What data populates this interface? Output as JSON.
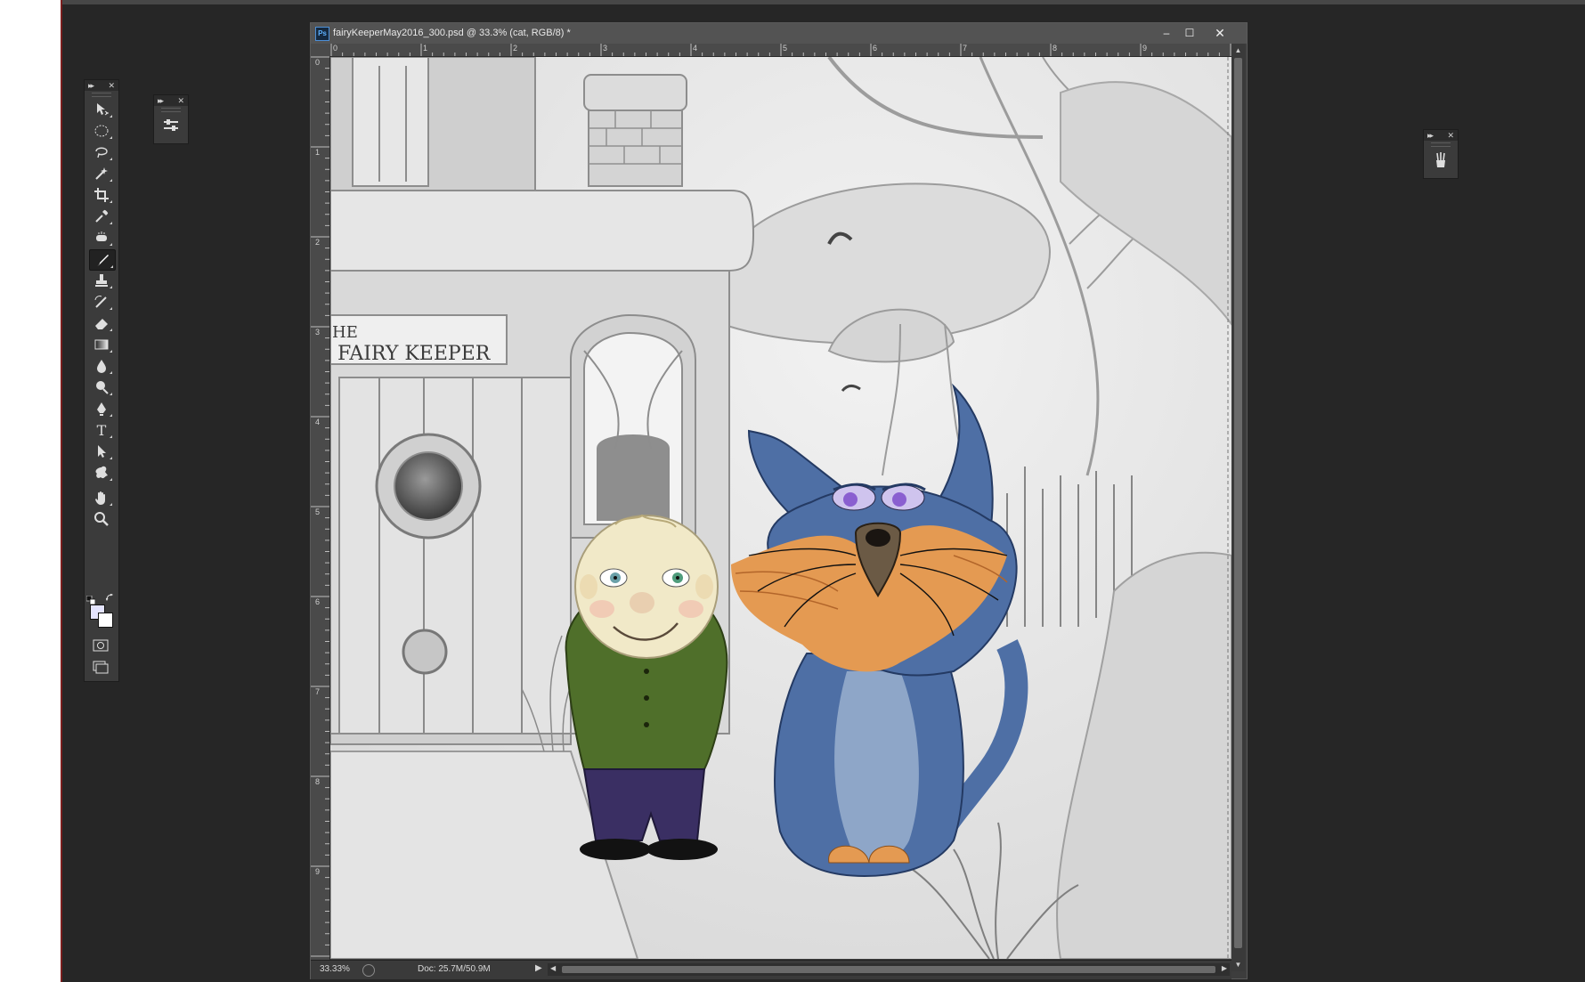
{
  "document": {
    "ps_badge": "Ps",
    "title": "fairyKeeperMay2016_300.psd @ 33.3% (cat, RGB/8) *",
    "window_buttons": {
      "minimize": "–",
      "maximize": "☐",
      "close": "✕"
    },
    "ruler_top_labels": [
      "0",
      "1",
      "2",
      "3",
      "4",
      "5",
      "6",
      "7",
      "8",
      "9"
    ],
    "ruler_left_labels": [
      "0",
      "1",
      "2",
      "3",
      "4",
      "5",
      "6",
      "7",
      "8",
      "9"
    ],
    "canvas_sign_line1": "HE",
    "canvas_sign_line2": "FAIRY KEEPER"
  },
  "status_bar": {
    "zoom": "33.33%",
    "doc_size": "Doc: 25.7M/50.9M",
    "arrow": "▶"
  },
  "tools_panel": {
    "collapse": "▸▸",
    "close": "✕",
    "tools": [
      {
        "name": "move-tool-icon"
      },
      {
        "name": "elliptical-marquee-tool-icon"
      },
      {
        "name": "lasso-tool-icon"
      },
      {
        "name": "magic-wand-tool-icon"
      },
      {
        "name": "crop-tool-icon"
      },
      {
        "name": "eyedropper-tool-icon"
      },
      {
        "name": "spot-healing-tool-icon"
      },
      {
        "name": "brush-tool-icon",
        "active": true
      },
      {
        "name": "clone-stamp-tool-icon"
      },
      {
        "name": "history-brush-tool-icon"
      },
      {
        "name": "eraser-tool-icon"
      },
      {
        "name": "gradient-tool-icon"
      },
      {
        "name": "blur-tool-icon"
      },
      {
        "name": "dodge-tool-icon"
      },
      {
        "name": "pen-tool-icon"
      },
      {
        "name": "type-tool-icon",
        "label": "T"
      },
      {
        "name": "path-selection-tool-icon"
      },
      {
        "name": "custom-shape-tool-icon"
      },
      {
        "name": "hand-tool-icon"
      },
      {
        "name": "zoom-tool-icon"
      }
    ],
    "foreground_color": "#e4e4ff",
    "background_color": "#ffffff"
  },
  "adjust_panel": {
    "collapse": "▸▸",
    "close": "✕",
    "icon": "adjustments-icon"
  },
  "brush_panel": {
    "collapse": "▸▸",
    "close": "✕",
    "icon": "brush-presets-icon"
  },
  "colors": {
    "workspace": "#262626",
    "panel": "#3b3b3b",
    "titlebar": "#535353",
    "cat_blue": "#4e6fa5",
    "cat_orange": "#e49a52",
    "jacket_green": "#4f6f2a",
    "trousers_purple": "#3a2f63"
  }
}
